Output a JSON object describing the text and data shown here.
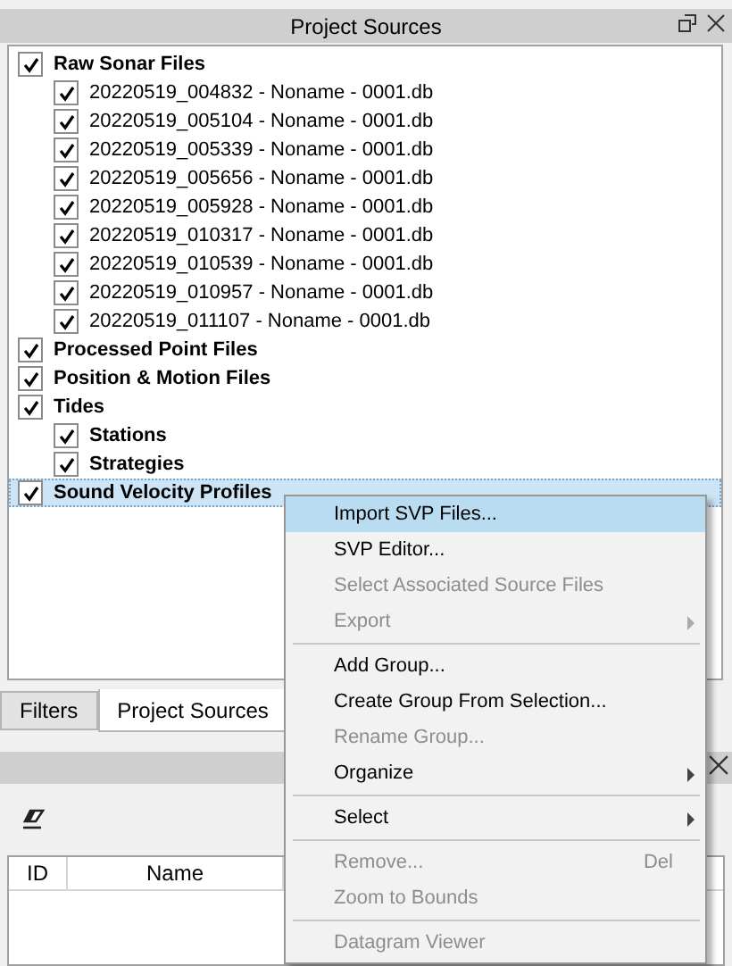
{
  "top_panel": {
    "title": "Project Sources"
  },
  "tree": [
    {
      "label": "Raw Sonar Files",
      "bold": true,
      "checked": true,
      "selected": false,
      "children": [
        {
          "label": "20220519_004832 - Noname - 0001.db",
          "bold": false,
          "checked": true,
          "selected": false
        },
        {
          "label": "20220519_005104 - Noname - 0001.db",
          "bold": false,
          "checked": true,
          "selected": false
        },
        {
          "label": "20220519_005339 - Noname - 0001.db",
          "bold": false,
          "checked": true,
          "selected": false
        },
        {
          "label": "20220519_005656 - Noname - 0001.db",
          "bold": false,
          "checked": true,
          "selected": false
        },
        {
          "label": "20220519_005928 - Noname - 0001.db",
          "bold": false,
          "checked": true,
          "selected": false
        },
        {
          "label": "20220519_010317 - Noname - 0001.db",
          "bold": false,
          "checked": true,
          "selected": false
        },
        {
          "label": "20220519_010539 - Noname - 0001.db",
          "bold": false,
          "checked": true,
          "selected": false
        },
        {
          "label": "20220519_010957 - Noname - 0001.db",
          "bold": false,
          "checked": true,
          "selected": false
        },
        {
          "label": "20220519_011107 - Noname - 0001.db",
          "bold": false,
          "checked": true,
          "selected": false
        }
      ]
    },
    {
      "label": "Processed Point Files",
      "bold": true,
      "checked": true,
      "selected": false
    },
    {
      "label": "Position & Motion Files",
      "bold": true,
      "checked": true,
      "selected": false
    },
    {
      "label": "Tides",
      "bold": true,
      "checked": true,
      "selected": false,
      "children": [
        {
          "label": "Stations",
          "bold": true,
          "checked": true,
          "selected": false
        },
        {
          "label": "Strategies",
          "bold": true,
          "checked": true,
          "selected": false
        }
      ]
    },
    {
      "label": "Sound Velocity Profiles",
      "bold": true,
      "checked": true,
      "selected": true
    }
  ],
  "tabs": [
    {
      "label": "Filters",
      "selected": false
    },
    {
      "label": "Project Sources",
      "selected": true
    }
  ],
  "table": {
    "columns": [
      "ID",
      "Name"
    ]
  },
  "context_menu": [
    {
      "kind": "item",
      "label": "Import SVP Files...",
      "disabled": false,
      "selected": true
    },
    {
      "kind": "item",
      "label": "SVP Editor...",
      "disabled": false,
      "selected": false
    },
    {
      "kind": "item",
      "label": "Select Associated Source Files",
      "disabled": true,
      "selected": false
    },
    {
      "kind": "item",
      "label": "Export",
      "disabled": true,
      "selected": false,
      "submenu": true
    },
    {
      "kind": "separator"
    },
    {
      "kind": "item",
      "label": "Add Group...",
      "disabled": false,
      "selected": false
    },
    {
      "kind": "item",
      "label": "Create Group From Selection...",
      "disabled": false,
      "selected": false
    },
    {
      "kind": "item",
      "label": "Rename Group...",
      "disabled": true,
      "selected": false
    },
    {
      "kind": "item",
      "label": "Organize",
      "disabled": false,
      "selected": false,
      "submenu": true
    },
    {
      "kind": "separator"
    },
    {
      "kind": "item",
      "label": "Select",
      "disabled": false,
      "selected": false,
      "submenu": true
    },
    {
      "kind": "separator"
    },
    {
      "kind": "item",
      "label": "Remove...",
      "disabled": true,
      "selected": false,
      "shortcut": "Del"
    },
    {
      "kind": "item",
      "label": "Zoom to Bounds",
      "disabled": true,
      "selected": false
    },
    {
      "kind": "separator"
    },
    {
      "kind": "item",
      "label": "Datagram Viewer",
      "disabled": true,
      "selected": false
    }
  ]
}
